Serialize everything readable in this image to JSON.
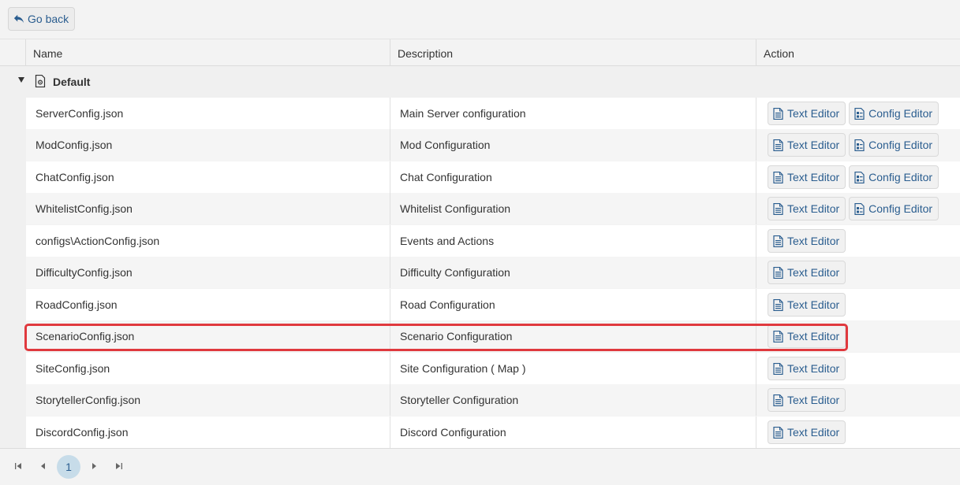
{
  "toolbar": {
    "back_label": "Go back"
  },
  "columns": {
    "name": "Name",
    "description": "Description",
    "action": "Action"
  },
  "group": {
    "label": "Default"
  },
  "rows": [
    {
      "name": "ServerConfig.json",
      "description": "Main Server configuration",
      "actions": [
        "Text Editor",
        "Config Editor"
      ]
    },
    {
      "name": "ModConfig.json",
      "description": "Mod Configuration",
      "actions": [
        "Text Editor",
        "Config Editor"
      ]
    },
    {
      "name": "ChatConfig.json",
      "description": "Chat Configuration",
      "actions": [
        "Text Editor",
        "Config Editor"
      ]
    },
    {
      "name": "WhitelistConfig.json",
      "description": "Whitelist Configuration",
      "actions": [
        "Text Editor",
        "Config Editor"
      ]
    },
    {
      "name": "configs\\ActionConfig.json",
      "description": "Events and Actions",
      "actions": [
        "Text Editor"
      ]
    },
    {
      "name": "DifficultyConfig.json",
      "description": "Difficulty Configuration",
      "actions": [
        "Text Editor"
      ]
    },
    {
      "name": "RoadConfig.json",
      "description": "Road Configuration",
      "actions": [
        "Text Editor"
      ]
    },
    {
      "name": "ScenarioConfig.json",
      "description": "Scenario Configuration",
      "actions": [
        "Text Editor"
      ],
      "highlighted": true
    },
    {
      "name": "SiteConfig.json",
      "description": "Site Configuration ( Map )",
      "actions": [
        "Text Editor"
      ]
    },
    {
      "name": "StorytellerConfig.json",
      "description": "Storyteller Configuration",
      "actions": [
        "Text Editor"
      ]
    },
    {
      "name": "DiscordConfig.json",
      "description": "Discord Configuration",
      "actions": [
        "Text Editor"
      ]
    }
  ],
  "pager": {
    "current_page": "1"
  },
  "colors": {
    "accent": "#2a5d8f",
    "highlight": "#e0393e",
    "page_active_bg": "#c7dce9"
  }
}
